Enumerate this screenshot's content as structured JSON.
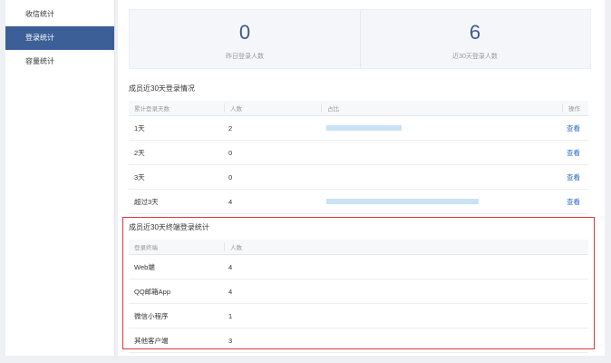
{
  "sidebar": {
    "items": [
      {
        "label": "收信统计"
      },
      {
        "label": "登录统计"
      },
      {
        "label": "容量统计"
      }
    ]
  },
  "stats": {
    "yesterday": {
      "value": "0",
      "label": "昨日登录人数"
    },
    "last30": {
      "value": "6",
      "label": "近30天登录人数"
    }
  },
  "login_days": {
    "title": "成员近30天登录情况",
    "headers": {
      "days": "累计登录天数",
      "count": "人数",
      "ratio": "占比",
      "action": "操作"
    },
    "rows": [
      {
        "days": "1天",
        "count": "2",
        "ratio": 0.33,
        "action": "查看"
      },
      {
        "days": "2天",
        "count": "0",
        "ratio": 0,
        "action": "查看"
      },
      {
        "days": "3天",
        "count": "0",
        "ratio": 0,
        "action": "查看"
      },
      {
        "days": "超过3天",
        "count": "4",
        "ratio": 0.67,
        "action": "查看"
      }
    ]
  },
  "terminal": {
    "title": "成员近30天终端登录统计",
    "headers": {
      "terminal": "登录终端",
      "count": "人数"
    },
    "rows": [
      {
        "terminal": "Web端",
        "count": "4"
      },
      {
        "terminal": "QQ邮箱App",
        "count": "4"
      },
      {
        "terminal": "微信小程序",
        "count": "1"
      },
      {
        "terminal": "其他客户端",
        "count": "3"
      }
    ]
  },
  "colors": {
    "accent": "#3d5f98",
    "link": "#2a6dcc",
    "bar": "#c9e2f6",
    "highlight": "#e0343a"
  }
}
